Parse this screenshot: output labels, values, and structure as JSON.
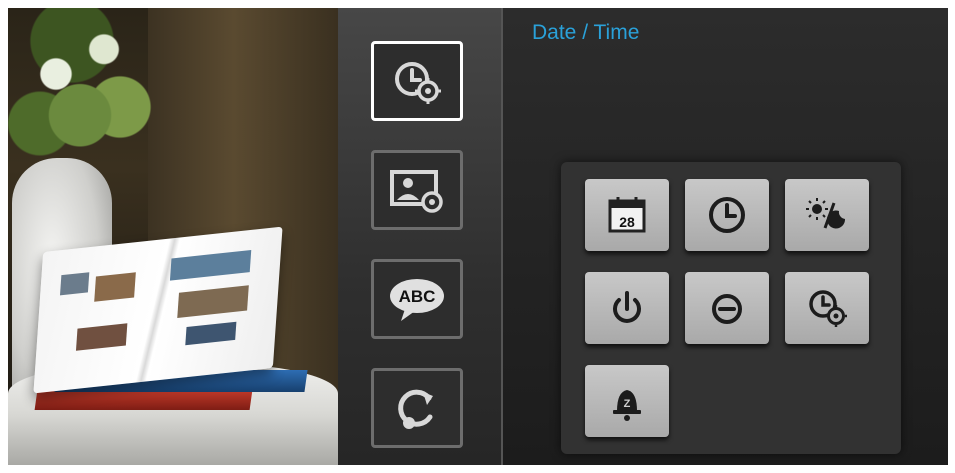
{
  "page": {
    "title": "Date / Time"
  },
  "sidebar": {
    "items": [
      {
        "name": "date-time-settings",
        "icon": "clock-gear-icon",
        "active": true
      },
      {
        "name": "photo-settings",
        "icon": "photo-gear-icon",
        "active": false
      },
      {
        "name": "language-settings",
        "icon": "speech-bubble-abc-icon",
        "label": "ABC",
        "active": false
      },
      {
        "name": "reset-settings",
        "icon": "reset-icon",
        "active": false
      }
    ]
  },
  "tiles": [
    {
      "name": "set-date",
      "icon": "calendar-icon",
      "label": "28"
    },
    {
      "name": "set-time",
      "icon": "clock-icon"
    },
    {
      "name": "day-night-mode",
      "icon": "sun-moon-icon"
    },
    {
      "name": "power-on-timer",
      "icon": "power-icon"
    },
    {
      "name": "power-off-timer",
      "icon": "power-off-minus-icon"
    },
    {
      "name": "clock-settings",
      "icon": "clock-gear-icon"
    },
    {
      "name": "alarm",
      "icon": "alarm-bell-icon",
      "label": "Z"
    }
  ],
  "colors": {
    "title": "#2aa1d9",
    "tile": "#bdbdbd",
    "active_border": "#ffffff"
  }
}
